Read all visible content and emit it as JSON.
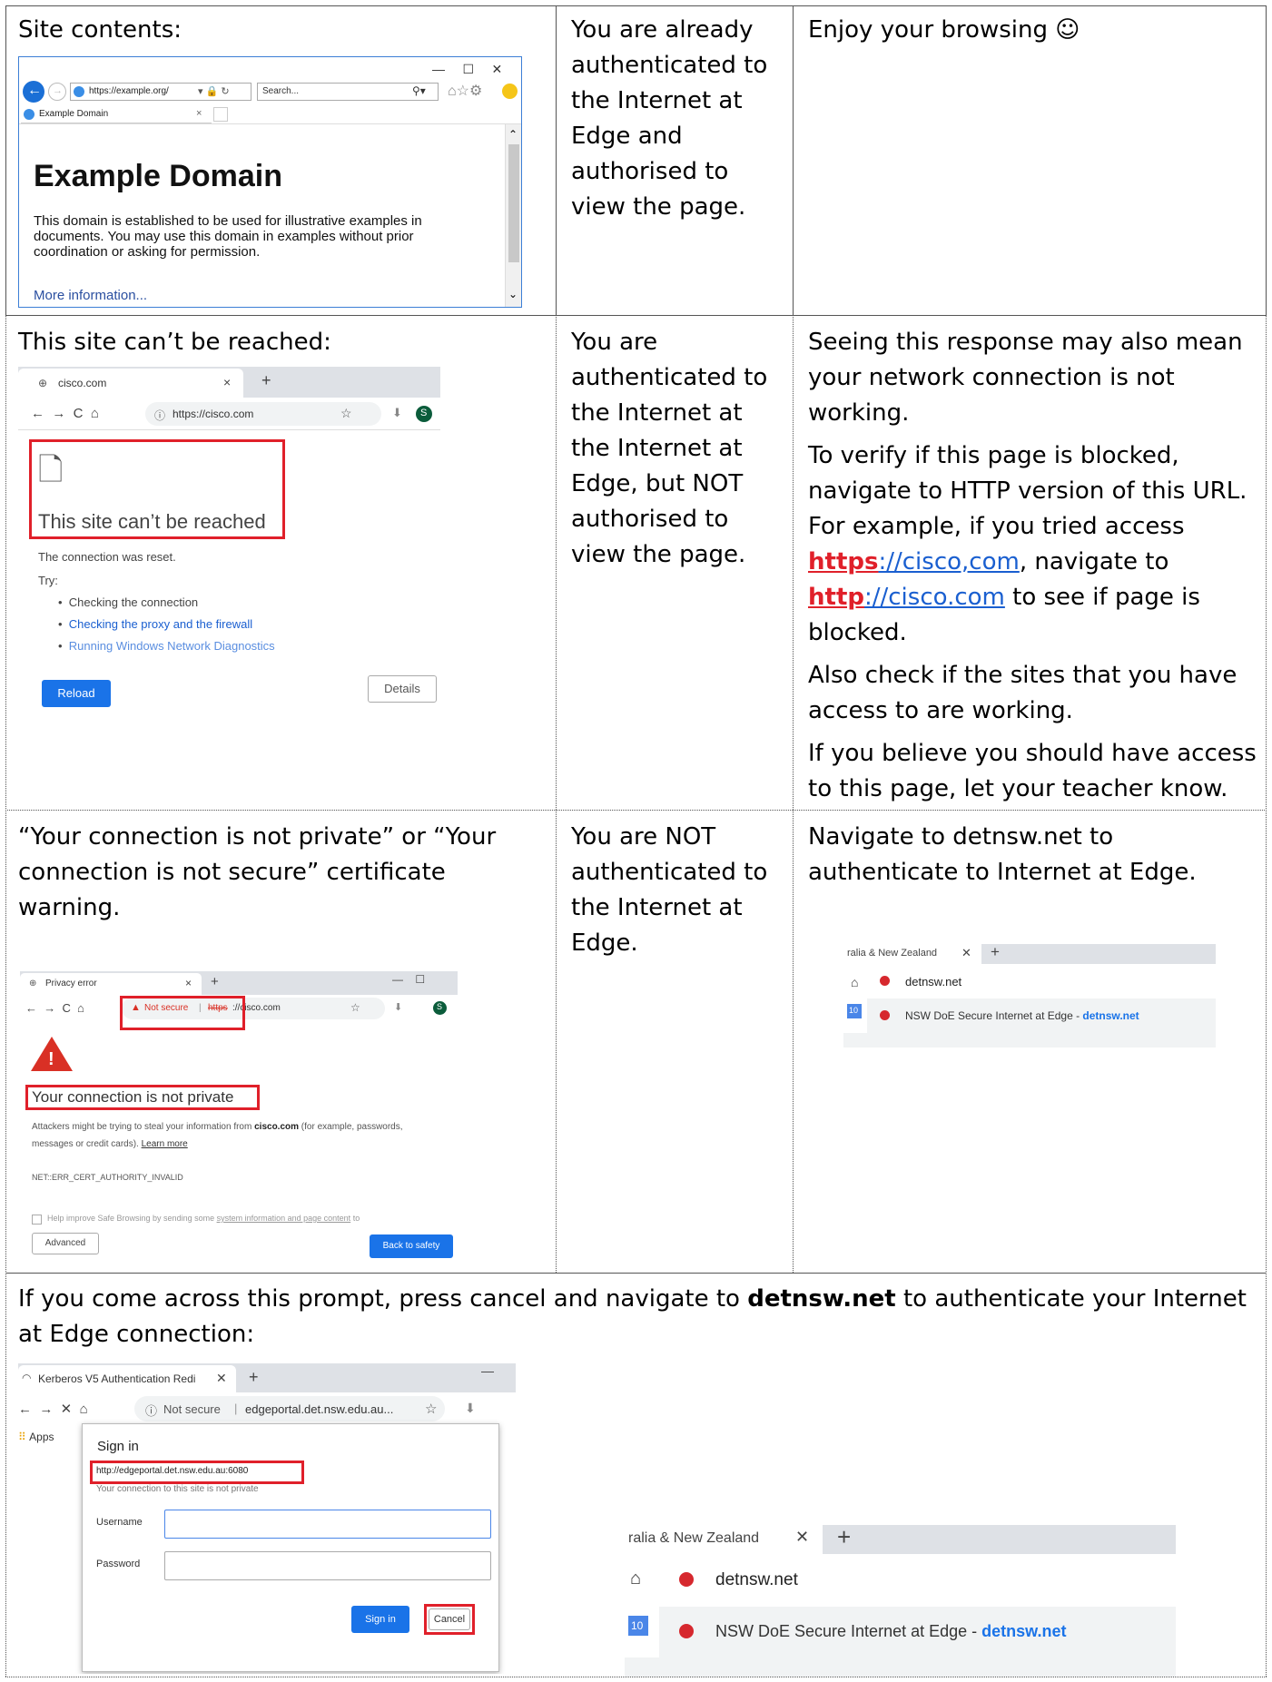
{
  "row1": {
    "col1_title": "Site contents:",
    "col2": "You are already authenticated to the Internet at Edge and authorised to view the page.",
    "col3": "Enjoy your browsing ☺",
    "ie": {
      "url": "https://example.org/",
      "search_placeholder": "Search...",
      "tab": "Example Domain",
      "heading": "Example Domain",
      "body": "This domain is established to be used for illustrative examples in documents. You may use this domain in examples without prior coordination or asking for permission.",
      "link": "More information..."
    }
  },
  "row2": {
    "col1_title": "This site can’t be reached:",
    "col2": "You are authenticated to the Internet at the Internet at Edge, but NOT authorised to view the page.",
    "col3": {
      "p1": "Seeing this response may also mean your network connection is not working.",
      "p2_a": "To verify if this page is blocked, navigate to HTTP version of this URL. For example, if you tried access ",
      "p2_https": "https",
      "p2_https_rest": "://cisco,com",
      "p2_b": ", navigate to ",
      "p2_http": "http",
      "p2_http_rest": "://cisco.com",
      "p2_c": " to see if page is blocked.",
      "p3": "Also check if the sites that you have access to are working.",
      "p4": "If you believe you should have access to this page, let your teacher know."
    },
    "chrome": {
      "tab": "cisco.com",
      "url": "https://cisco.com",
      "avatar": "S",
      "heading": "This site can’t be reached",
      "reset": "The connection was reset.",
      "try": "Try:",
      "items": [
        "Checking the connection",
        "Checking the proxy and the firewall",
        "Running Windows Network Diagnostics"
      ],
      "reload": "Reload",
      "details": "Details"
    }
  },
  "row3": {
    "col1_title": "“Your connection is not private” or “Your connection is not secure” certificate warning.",
    "col2": "You are NOT authenticated to the Internet at Edge.",
    "col3": "Navigate to detnsw.net to authenticate to Internet at Edge.",
    "privacy": {
      "tab": "Privacy error",
      "not_secure": "Not secure",
      "url_strike": "https",
      "url_rest": "://cisco.com",
      "avatar": "S",
      "heading": "Your connection is not private",
      "body_a": "Attackers might be trying to steal your information from ",
      "body_site": "cisco.com",
      "body_b": " (for example, passwords, messages or credit cards). ",
      "learn": "Learn more",
      "code": "NET::ERR_CERT_AUTHORITY_INVALID",
      "help_a": "Help improve Safe Browsing by sending some ",
      "help_link": "system information and page content",
      "help_b": " to",
      "advanced": "Advanced",
      "back": "Back to safety"
    },
    "omni": {
      "tab": "ralia & New Zealand",
      "query": "detnsw.net",
      "suggestion_a": "NSW DoE Secure Internet at Edge - ",
      "suggestion_b": "detnsw.net",
      "calendar_num": "10"
    }
  },
  "row4": {
    "text_a": "If you come across this prompt, press cancel and navigate to ",
    "text_bold": "detnsw.net",
    "text_b": " to authenticate your Internet at Edge connection:",
    "kerberos": {
      "tab": "Kerberos V5 Authentication Redi",
      "not_secure": "Not secure",
      "url": "edgeportal.det.nsw.edu.au...",
      "apps": "Apps",
      "dialog_title": "Sign in",
      "dialog_url": "http://edgeportal.det.nsw.edu.au:6080",
      "dialog_note": "Your connection to this site is not private",
      "username_label": "Username",
      "password_label": "Password",
      "sign_in": "Sign in",
      "cancel": "Cancel"
    },
    "omni": {
      "tab": "ralia & New Zealand",
      "query": "detnsw.net",
      "suggestion_a": "NSW DoE Secure Internet at Edge - ",
      "suggestion_b": "detnsw.net",
      "calendar_num": "10"
    }
  }
}
